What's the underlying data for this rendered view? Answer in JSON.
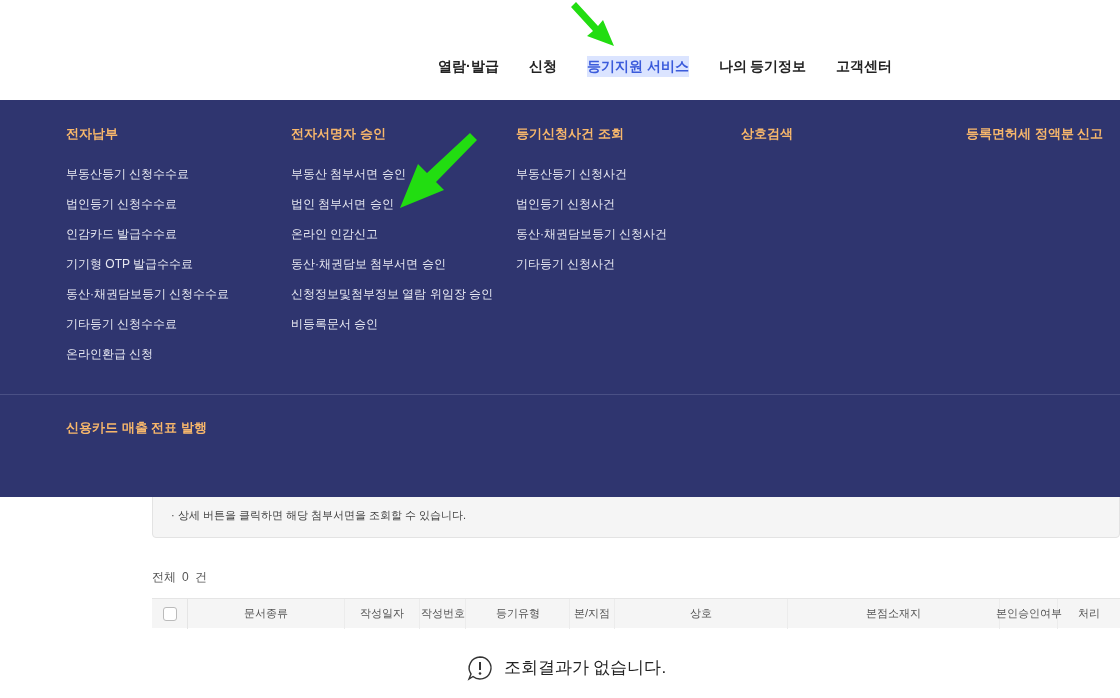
{
  "nav": [
    {
      "label": "열람·발급",
      "selected": false
    },
    {
      "label": "신청",
      "selected": false
    },
    {
      "label": "등기지원 서비스",
      "selected": true
    },
    {
      "label": "나의 등기정보",
      "selected": false
    },
    {
      "label": "고객센터",
      "selected": false
    }
  ],
  "mega_menu": {
    "columns": [
      {
        "heading": "전자납부",
        "items": [
          "부동산등기 신청수수료",
          "법인등기 신청수수료",
          "인감카드 발급수수료",
          "기기형 OTP 발급수수료",
          "동산·채권담보등기 신청수수료",
          "기타등기 신청수수료",
          "온라인환급 신청"
        ]
      },
      {
        "heading": "전자서명자 승인",
        "items": [
          "부동산 첨부서면 승인",
          "법인 첨부서면 승인",
          "온라인 인감신고",
          "동산·채권담보 첨부서면 승인",
          "신청정보및첨부정보 열람 위임장 승인",
          "비등록문서 승인"
        ]
      },
      {
        "heading": "등기신청사건 조회",
        "items": [
          "부동산등기 신청사건",
          "법인등기 신청사건",
          "동산·채권담보등기 신청사건",
          "기타등기 신청사건"
        ]
      },
      {
        "heading": "상호검색"
      },
      {
        "heading": "등록면허세 정액분 신고"
      }
    ],
    "bottom_heading": "신용카드 매출 전표 발행"
  },
  "notice": [
    "· 상세 버튼을 클릭하면 해당 첨부서면을 조회할 수 있습니다."
  ],
  "total": {
    "prefix": "전체",
    "count": "0",
    "suffix": "건"
  },
  "table": {
    "select_all": {
      "checked": false
    },
    "columns": [
      "문서종류",
      "작성일자",
      "작성번호",
      "등기유형",
      "본/지점",
      "상호",
      "본점소재지",
      "본인승인여부",
      "처리"
    ]
  },
  "empty_message": "조회결과가 없습니다."
}
